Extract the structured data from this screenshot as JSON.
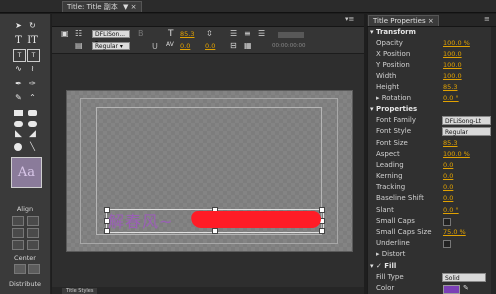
{
  "title_panel": {
    "tab_label": "Title: Title 副本",
    "tab_menu": "▼ ×",
    "panel_menu": "▾≡",
    "font_family": "DFLiSon...",
    "font_style": "Regular",
    "font_size": "85.3",
    "kerning": "0.0",
    "leading": "0.0",
    "timecode": "00:00:00:00"
  },
  "tools_panel": {
    "align_label": "Align",
    "center_label": "Center",
    "distribute_label": "Distribute",
    "style_sample": "Aa"
  },
  "canvas": {
    "text": "解春风~"
  },
  "bottom_tab": "Title Styles",
  "properties_panel": {
    "tab_label": "Title Properties ×",
    "panel_menu": "≡",
    "transform_header": "Transform",
    "properties_header": "Properties",
    "fill_header": "Fill",
    "transform_rows": [
      {
        "label": "Opacity",
        "value": "100.0 %"
      },
      {
        "label": "X Position",
        "value": "100.0"
      },
      {
        "label": "Y Position",
        "value": "100.0"
      },
      {
        "label": "Width",
        "value": "100.0"
      },
      {
        "label": "Height",
        "value": "85.3"
      },
      {
        "label": "Rotation",
        "value": "0.0 °"
      }
    ],
    "font_family_label": "Font Family",
    "font_family_value": "DFLiSong-Lt",
    "font_style_label": "Font Style",
    "font_style_value": "Regular",
    "property_rows": [
      {
        "label": "Font Size",
        "value": "85.3"
      },
      {
        "label": "Aspect",
        "value": "100.0 %"
      },
      {
        "label": "Leading",
        "value": "0.0"
      },
      {
        "label": "Kerning",
        "value": "0.0"
      },
      {
        "label": "Tracking",
        "value": "0.0"
      },
      {
        "label": "Baseline Shift",
        "value": "0.0"
      },
      {
        "label": "Slant",
        "value": "0.0 °"
      }
    ],
    "small_caps_label": "Small Caps",
    "small_caps_size_label": "Small Caps Size",
    "small_caps_size_value": "75.0 %",
    "underline_label": "Underline",
    "distort_label": "Distort",
    "fill_type_label": "Fill Type",
    "fill_type_value": "Solid",
    "color_label": "Color",
    "fill_color": "#7b3fb6"
  }
}
